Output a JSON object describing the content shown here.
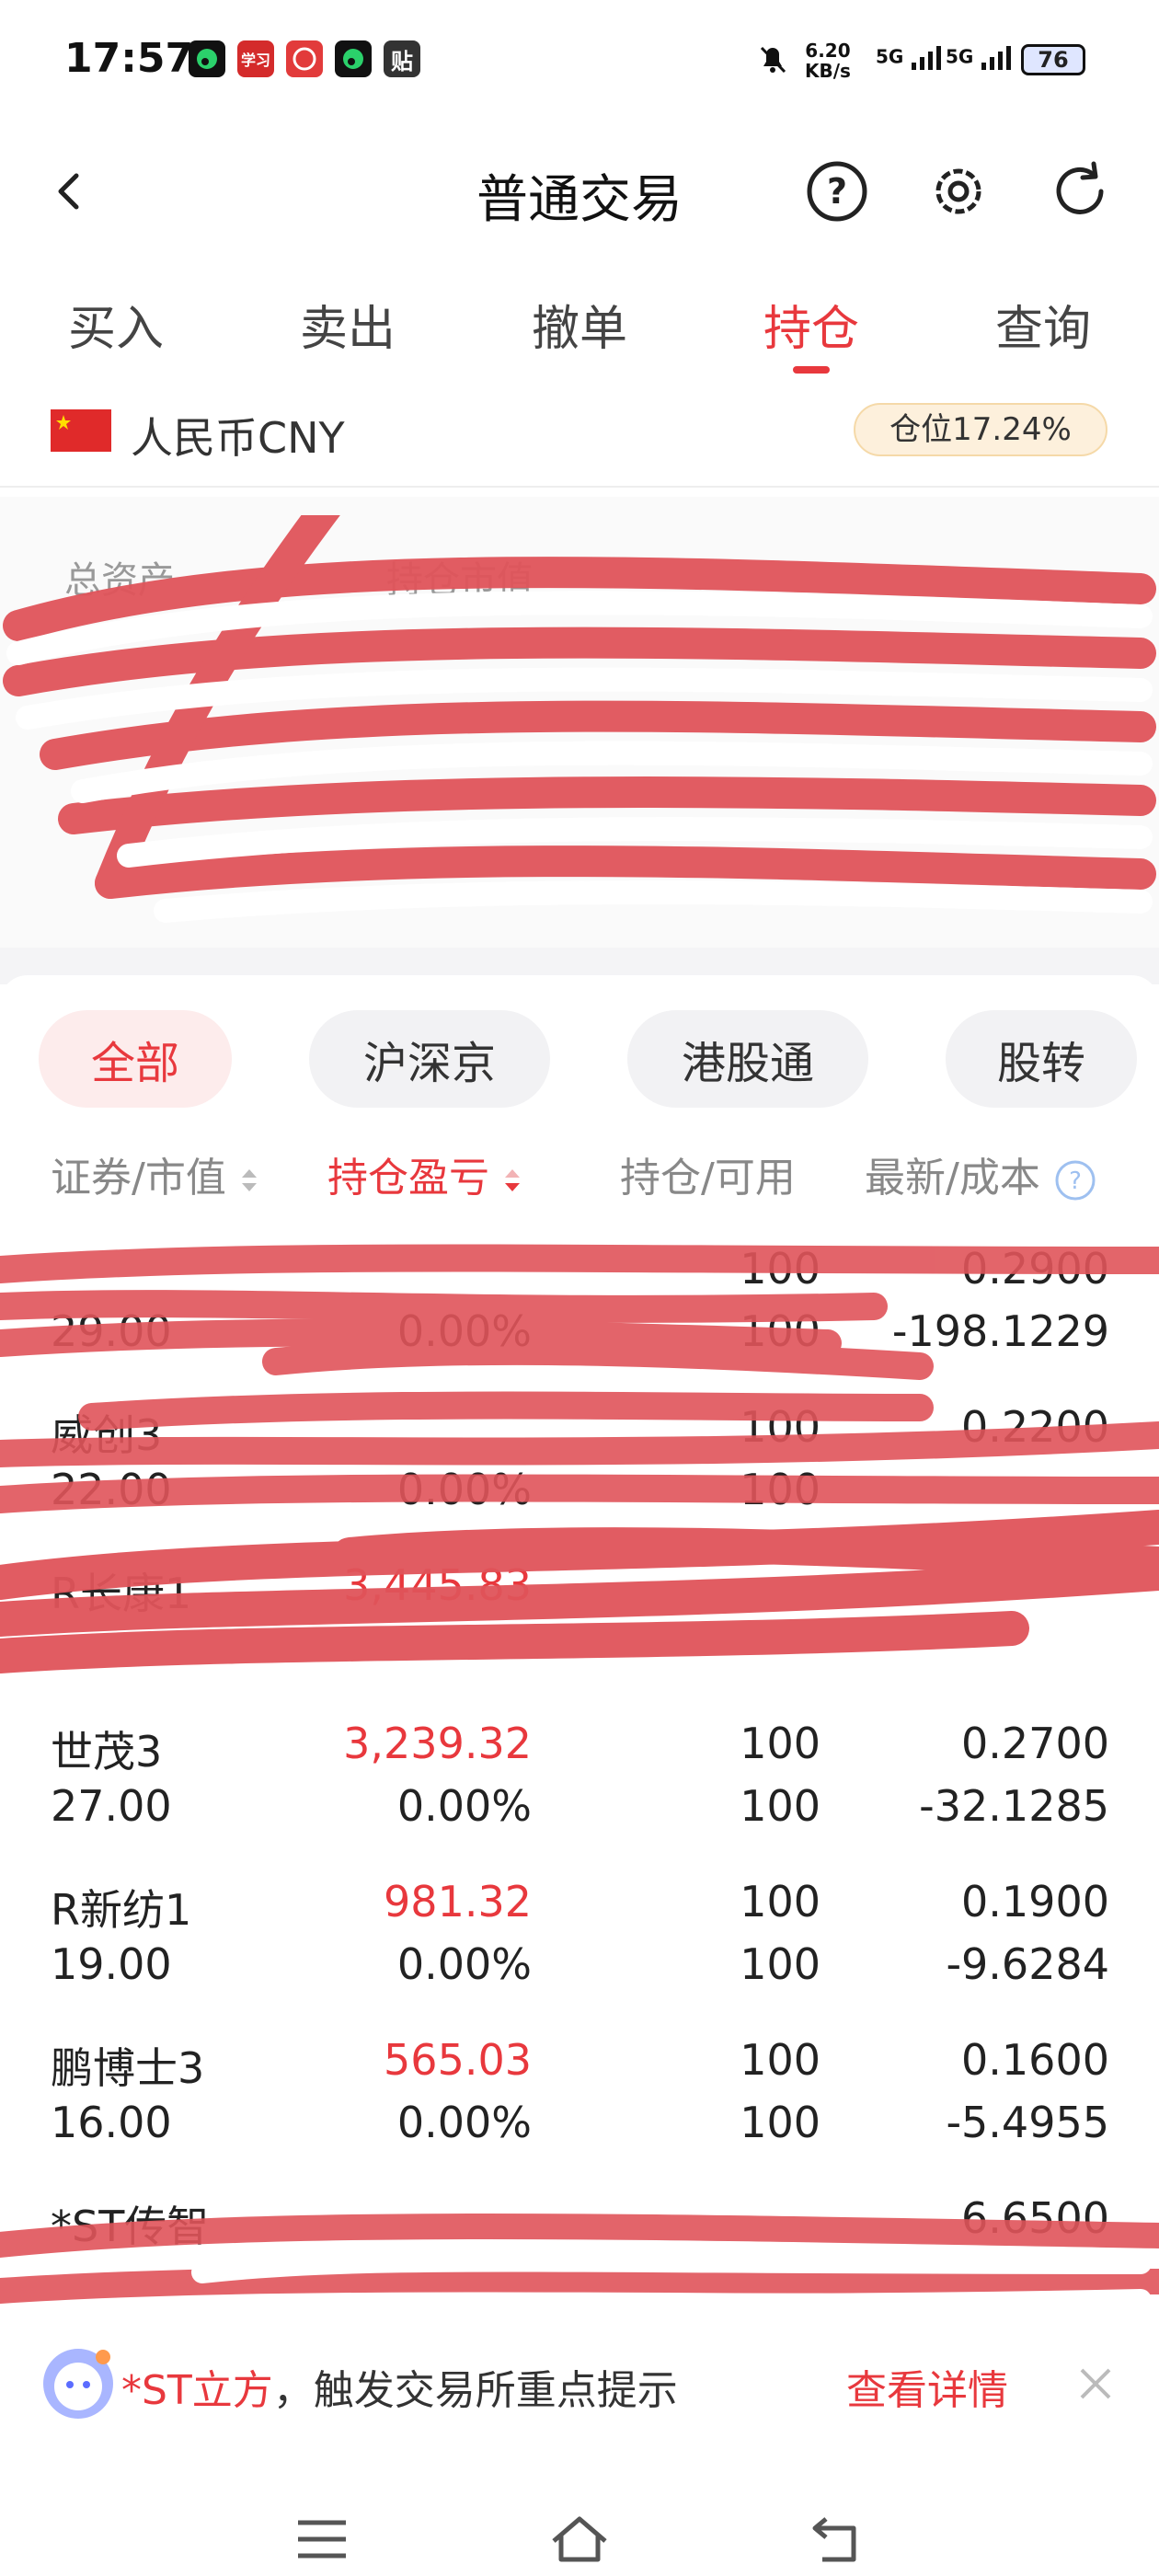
{
  "status_bar": {
    "time": "17:57",
    "apps": [
      "qq-music-icon",
      "learning-icon",
      "app-icon",
      "qq-music-icon",
      "tieba-icon"
    ],
    "app_labels": [
      "",
      "学习",
      "",
      "",
      "贴"
    ],
    "net_speed_top": "6.20",
    "net_speed_bottom": "KB/s",
    "sig1": "5G",
    "sig2": "5G",
    "battery": "76"
  },
  "nav": {
    "title": "普通交易"
  },
  "tabs": [
    {
      "label": "买入"
    },
    {
      "label": "卖出"
    },
    {
      "label": "撤单"
    },
    {
      "label": "持仓"
    },
    {
      "label": "查询"
    }
  ],
  "currency": {
    "label": "人民币CNY",
    "position_badge": "仓位17.24%"
  },
  "summary": {
    "total_assets_label": "总资产",
    "market_value_label": "持仓市值"
  },
  "filters": [
    {
      "label": "全部"
    },
    {
      "label": "沪深京"
    },
    {
      "label": "港股通"
    },
    {
      "label": "股转"
    }
  ],
  "headers": {
    "security": "证券/市值",
    "pnl": "持仓盈亏",
    "position": "持仓/可用",
    "latest": "最新/成本"
  },
  "rows": [
    {
      "name": "",
      "value": "29.00",
      "pnl": "",
      "pnl_pct": "0.00%",
      "hold": "100",
      "avail": "100",
      "latest": "0.2900",
      "cost": "-198.1229"
    },
    {
      "name": "威创3",
      "value": "22.00",
      "pnl": "",
      "pnl_pct": "0.00%",
      "hold": "100",
      "avail": "100",
      "latest": "0.2200",
      "cost": ""
    },
    {
      "name": "R长康1",
      "value": "",
      "pnl": "3,445.83",
      "pnl_pct": "",
      "hold": "",
      "avail": "",
      "latest": "",
      "cost": ""
    },
    {
      "name": "世茂3",
      "value": "27.00",
      "pnl": "3,239.32",
      "pnl_pct": "0.00%",
      "hold": "100",
      "avail": "100",
      "latest": "0.2700",
      "cost": "-32.1285"
    },
    {
      "name": "R新纺1",
      "value": "19.00",
      "pnl": "981.32",
      "pnl_pct": "0.00%",
      "hold": "100",
      "avail": "100",
      "latest": "0.1900",
      "cost": "-9.6284"
    },
    {
      "name": "鹏博士3",
      "value": "16.00",
      "pnl": "565.03",
      "pnl_pct": "0.00%",
      "hold": "100",
      "avail": "100",
      "latest": "0.1600",
      "cost": "-5.4955"
    },
    {
      "name": "*ST传智",
      "value": "",
      "pnl": "",
      "pnl_pct": "",
      "hold": "",
      "avail": "",
      "latest": "6.6500",
      "cost": ""
    }
  ],
  "notice": {
    "highlight": "*ST立方",
    "text": "，触发交易所重点提示",
    "link": "查看详情"
  },
  "colors": {
    "accent": "#e8383d",
    "scribble": "#e0545a"
  }
}
